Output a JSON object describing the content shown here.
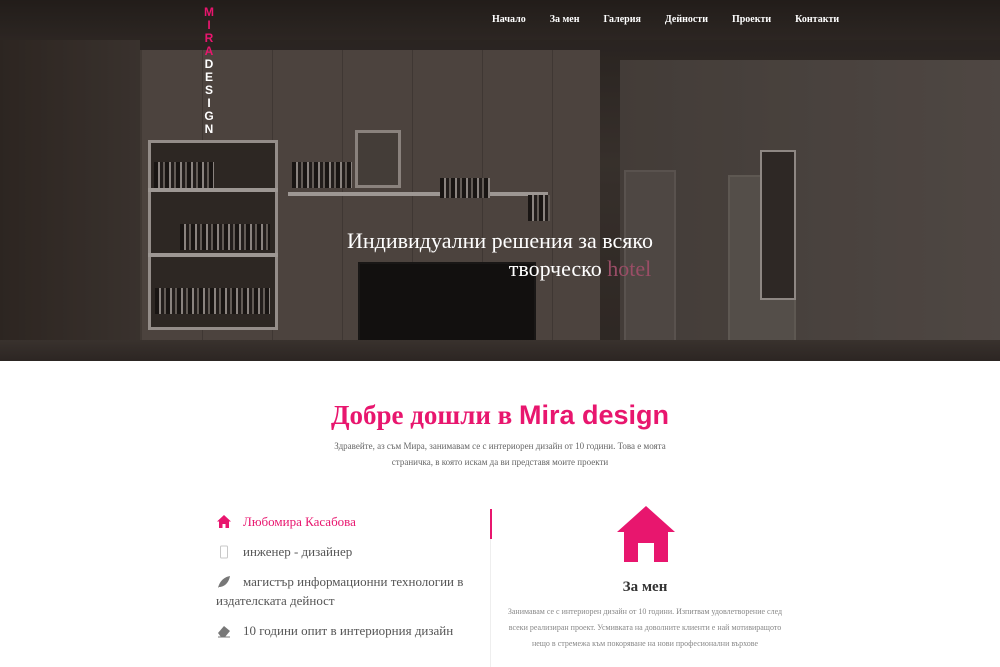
{
  "logo": {
    "mira_letters": [
      "M",
      "I",
      "R",
      "A"
    ],
    "design_letters": [
      "D",
      "E",
      "S",
      "I",
      "G",
      "N"
    ],
    "accent_color": "#e8166e"
  },
  "nav": {
    "items": [
      "Начало",
      "За мен",
      "Галерия",
      "Дейности",
      "Проекти",
      "Контакти"
    ]
  },
  "hero": {
    "headline_line1": "Индивидуални решения за всяко",
    "headline_line2": "творческо",
    "headline_accent": "hotel"
  },
  "welcome": {
    "title_prefix": "Добре дошли в",
    "title_brand": "Mira design",
    "text": "Здравейте, аз съм Мира, занимавам се с интериорен дизайн от 10 години. Това е моята страничка, в която искам да ви представя моите проекти"
  },
  "info": {
    "items": [
      {
        "icon": "home-icon",
        "label": "Любомира Касабова",
        "active": true
      },
      {
        "icon": "mobile-icon",
        "label": "инженер - дизайнер",
        "active": false
      },
      {
        "icon": "leaf-icon",
        "label": "магистър информационни технологии в издателската дейност",
        "active": false
      },
      {
        "icon": "eraser-icon",
        "label": "10 години опит в интериорния дизайн",
        "active": false
      }
    ]
  },
  "about": {
    "icon": "house-icon",
    "title": "За мен",
    "text": "Занимавам се с интериорен дизайн от 10 години. Изпитвам удовлетворение след всеки реализиран проект. Усмивката на доволните клиенти е най мотивиращото нещо в стремежа към покоряване на нови професионални върхове"
  }
}
